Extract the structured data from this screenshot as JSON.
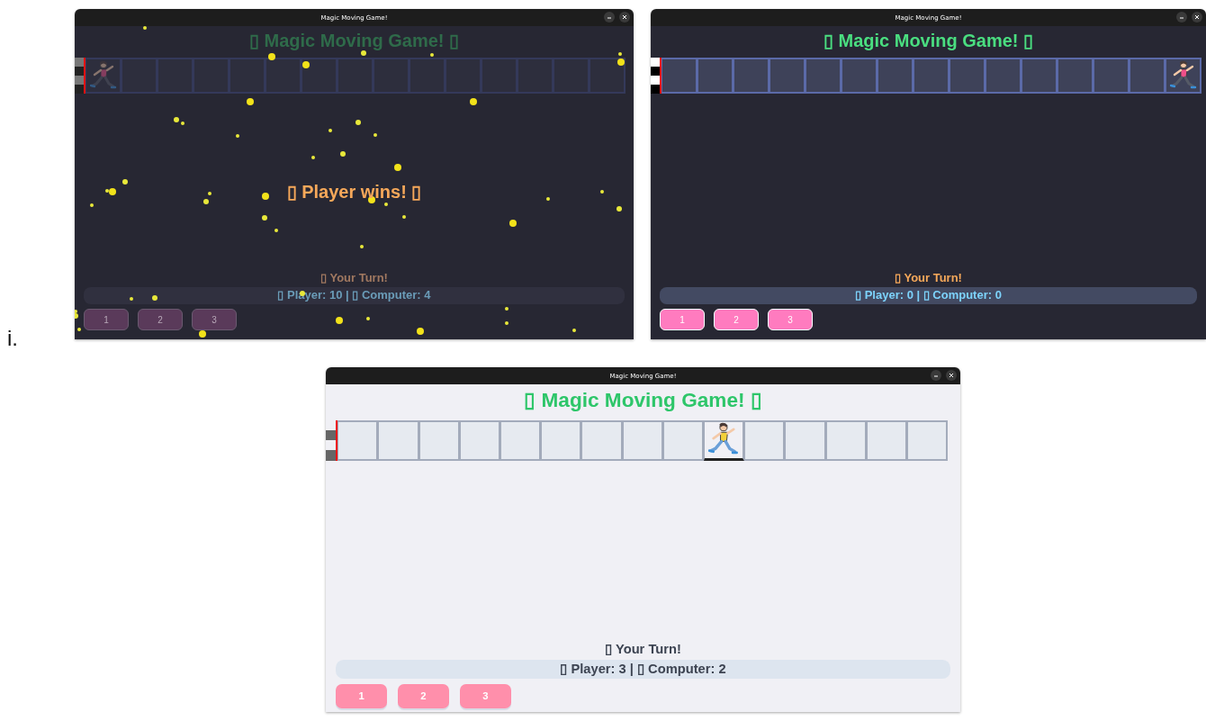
{
  "label": "i.",
  "windows": [
    {
      "title": "Magic Moving Game!",
      "dark": true,
      "dimmed": true,
      "heading": "▯ Magic Moving Game! ▯",
      "cells": [
        {
          "runner": true
        },
        {
          "runner": false
        },
        {
          "runner": false
        },
        {
          "runner": false
        },
        {
          "runner": false
        },
        {
          "runner": false
        },
        {
          "runner": false
        },
        {
          "runner": false
        },
        {
          "runner": false
        },
        {
          "runner": false
        },
        {
          "runner": false
        },
        {
          "runner": false
        },
        {
          "runner": false
        },
        {
          "runner": false
        },
        {
          "runner": false
        }
      ],
      "overlay": {
        "message": "▯ Player wins! ▯"
      },
      "turn": "▯ Your Turn!",
      "score": "▯ Player: 10 | ▯ Computer: 4",
      "buttons": [
        "1",
        "2",
        "3"
      ]
    },
    {
      "title": "Magic Moving Game!",
      "dark": true,
      "dimmed": false,
      "heading": "▯ Magic Moving Game! ▯",
      "cells": [
        {
          "runner": false
        },
        {
          "runner": false
        },
        {
          "runner": false
        },
        {
          "runner": false
        },
        {
          "runner": false
        },
        {
          "runner": false
        },
        {
          "runner": false
        },
        {
          "runner": false
        },
        {
          "runner": false
        },
        {
          "runner": false
        },
        {
          "runner": false
        },
        {
          "runner": false
        },
        {
          "runner": false
        },
        {
          "runner": false
        },
        {
          "runner": true
        }
      ],
      "turn": "▯ Your Turn!",
      "score": "▯ Player: 0 | ▯ Computer: 0",
      "buttons": [
        "1",
        "2",
        "3"
      ]
    },
    {
      "title": "Magic Moving Game!",
      "dark": false,
      "dimmed": false,
      "heading": "▯ Magic Moving Game! ▯",
      "cells": [
        {
          "runner": false
        },
        {
          "runner": false
        },
        {
          "runner": false
        },
        {
          "runner": false
        },
        {
          "runner": false
        },
        {
          "runner": false
        },
        {
          "runner": false
        },
        {
          "runner": false
        },
        {
          "runner": false
        },
        {
          "runner": true
        },
        {
          "runner": false
        },
        {
          "runner": false
        },
        {
          "runner": false
        },
        {
          "runner": false
        },
        {
          "runner": false
        }
      ],
      "turn": "▯ Your Turn!",
      "score": "▯ Player: 3 | ▯ Computer: 2",
      "buttons": [
        "1",
        "2",
        "3"
      ]
    }
  ]
}
